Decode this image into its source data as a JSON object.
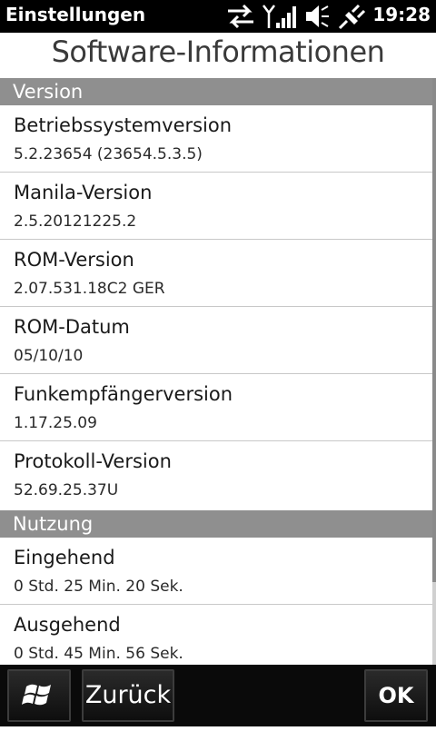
{
  "status": {
    "app_title": "Einstellungen",
    "time": "19:28",
    "icons": [
      "data-sync-icon",
      "signal-strength-icon",
      "speaker-icon",
      "charging-plug-icon"
    ]
  },
  "page": {
    "title": "Software-Informationen"
  },
  "sections": [
    {
      "header": "Version",
      "items": [
        {
          "label": "Betriebssystemversion",
          "value": "5.2.23654 (23654.5.3.5)"
        },
        {
          "label": "Manila-Version",
          "value": "2.5.20121225.2"
        },
        {
          "label": "ROM-Version",
          "value": "2.07.531.18C2 GER"
        },
        {
          "label": "ROM-Datum",
          "value": "05/10/10"
        },
        {
          "label": "Funkempfängerversion",
          "value": "1.17.25.09"
        },
        {
          "label": "Protokoll-Version",
          "value": "52.69.25.37U"
        }
      ]
    },
    {
      "header": "Nutzung",
      "items": [
        {
          "label": "Eingehend",
          "value": "0 Std. 25 Min. 20 Sek."
        },
        {
          "label": "Ausgehend",
          "value": "0 Std. 45 Min. 56 Sek."
        }
      ]
    }
  ],
  "bottom_bar": {
    "start_icon": "windows-start-icon",
    "back_label": "Zurück",
    "ok_label": "OK"
  }
}
